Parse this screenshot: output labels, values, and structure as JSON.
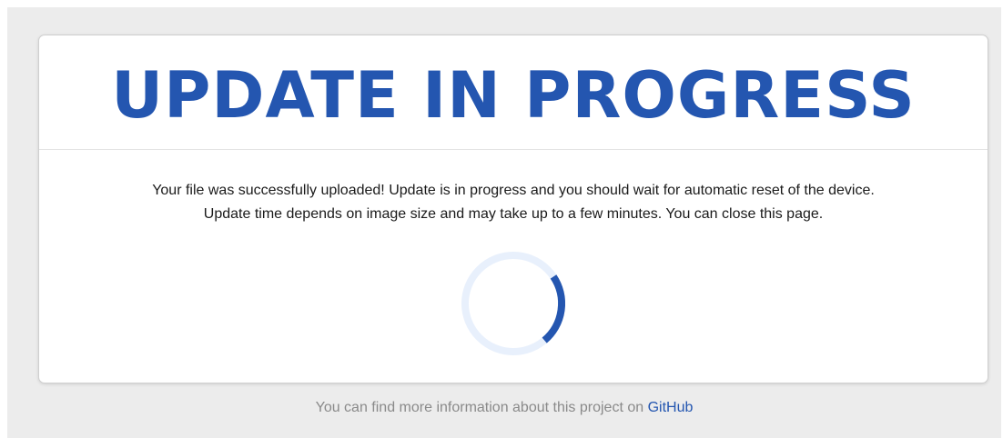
{
  "card": {
    "title": "UPDATE IN PROGRESS",
    "message_line_1": "Your file was successfully uploaded! Update is in progress and you should wait for automatic reset of the device.",
    "message_line_2": "Update time depends on image size and may take up to a few minutes. You can close this page.",
    "spinner_icon": "loading-spinner"
  },
  "footer": {
    "text": "You can find more information about this project on",
    "link_text": "GitHub"
  },
  "colors": {
    "accent": "#2456b0",
    "spinner_track": "#e8f0fc",
    "background": "#ececec",
    "footer_text": "#8a8a8a"
  }
}
